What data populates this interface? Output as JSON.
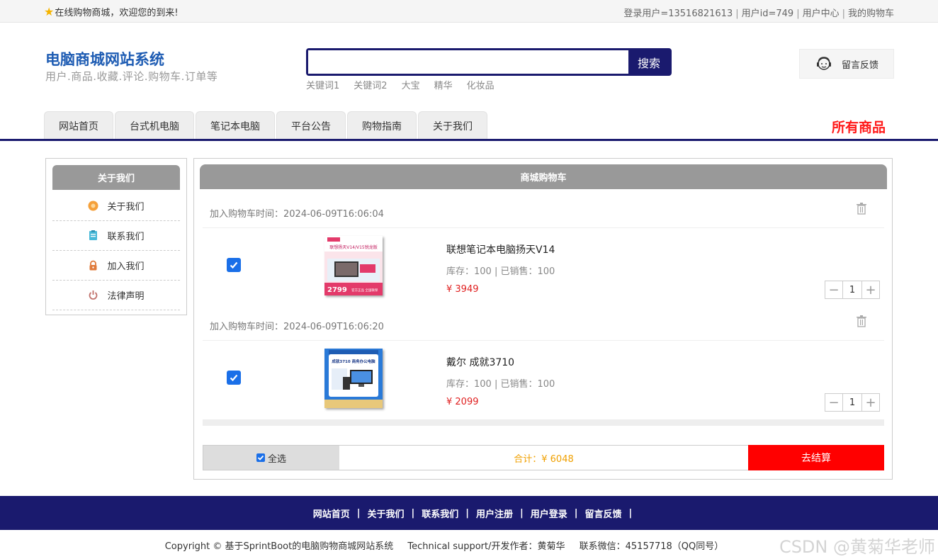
{
  "topbar": {
    "welcome": "在线购物商城，欢迎您的到来!",
    "links": [
      "登录用户=13516821613",
      "用户id=749",
      "用户中心",
      "我的购物车"
    ]
  },
  "header": {
    "title": "电脑商城网站系统",
    "subtitle": "用户.商品.收藏.评论.购物车.订单等",
    "search_placeholder": "",
    "search_button": "搜索",
    "hotwords": [
      "关键词1",
      "关键词2",
      "大宝",
      "精华",
      "化妆品"
    ],
    "feedback": "留言反馈"
  },
  "nav": {
    "tabs": [
      "网站首页",
      "台式机电脑",
      "笔记本电脑",
      "平台公告",
      "购物指南",
      "关于我们"
    ],
    "all_goods": "所有商品"
  },
  "sidebar": {
    "title": "关于我们",
    "items": [
      {
        "label": "关于我们",
        "icon": "about-icon"
      },
      {
        "label": "联系我们",
        "icon": "contact-icon"
      },
      {
        "label": "加入我们",
        "icon": "lock-icon"
      },
      {
        "label": "法律声明",
        "icon": "power-icon"
      }
    ]
  },
  "cart": {
    "title": "商城购物车",
    "items": [
      {
        "added": "加入购物车时间：2024-06-09T16:06:04",
        "name": "联想笔记本电脑扬天V14",
        "stock": "库存：100 | 已销售：100",
        "price": "¥ 3949",
        "qty": "1",
        "checked": true,
        "thumb_text": [
          "联想扬天V14/V15锐龙版",
          "2799",
          "官方正品 全国联保"
        ]
      },
      {
        "added": "加入购物车时间：2024-06-09T16:06:20",
        "name": "戴尔 成就3710",
        "stock": "库存：100 | 已销售：100",
        "price": "¥ 2099",
        "qty": "1",
        "checked": true,
        "thumb_text": [
          "成就3710 商务办公电脑"
        ]
      }
    ],
    "select_all": "全选",
    "total": "合计：¥ 6048",
    "checkout": "去结算"
  },
  "footer": {
    "links": [
      "网站首页",
      "关于我们",
      "联系我们",
      "用户注册",
      "用户登录",
      "留言反馈"
    ],
    "copyright": "Copyright © 基于SprintBoot的电脑购物商城网站系统",
    "support": "Technical support/开发作者：黄菊华",
    "contact": "联系微信：45157718（QQ同号）"
  },
  "watermark": "CSDN @黄菊华老师",
  "colors": {
    "brand_navy": "#1a1a6e",
    "title_blue": "#1e5cb3",
    "price_red": "#e02020",
    "checkout_red": "#ff0000",
    "total_orange": "#f0a000"
  }
}
